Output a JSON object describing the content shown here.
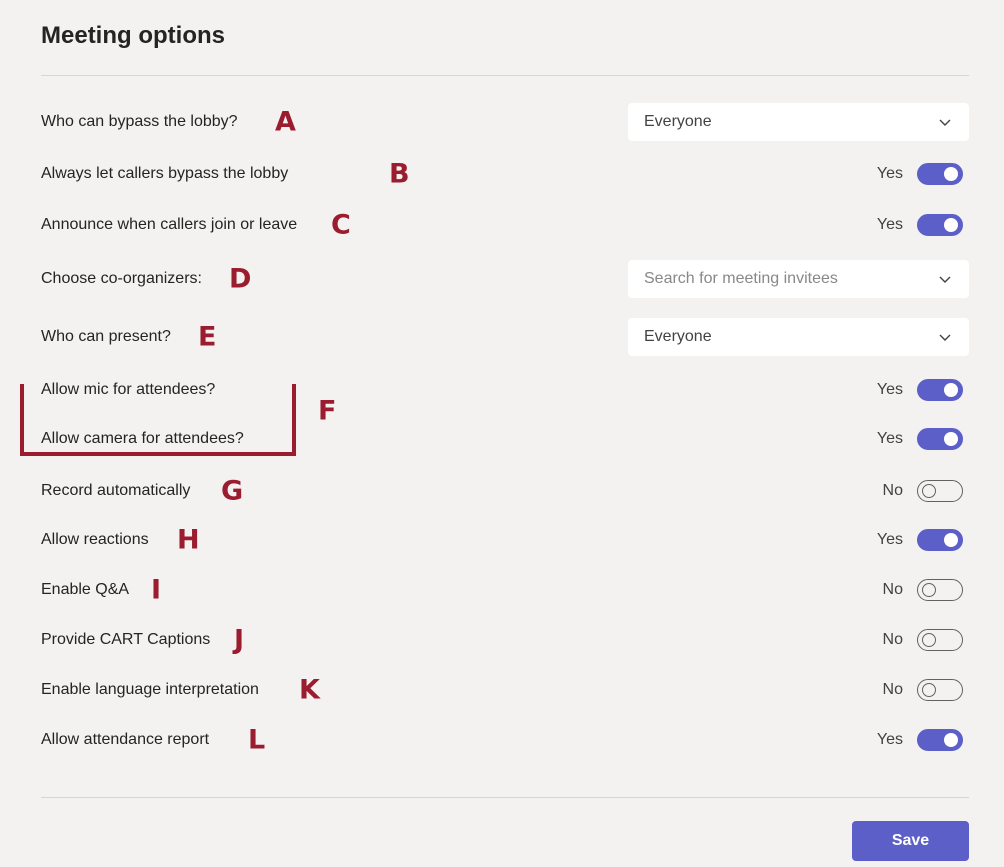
{
  "page": {
    "title": "Meeting options",
    "save_label": "Save"
  },
  "colors": {
    "accent": "#5b5fc7",
    "annotation": "#9b1c2e",
    "background": "#f3f2f1"
  },
  "options": {
    "lobby_bypass": {
      "label": "Who can bypass the lobby?",
      "annotation": "A",
      "value": "Everyone"
    },
    "callers_bypass": {
      "label": "Always let callers bypass the lobby",
      "annotation": "B",
      "state_text": "Yes",
      "on": true
    },
    "announce_callers": {
      "label": "Announce when callers join or leave",
      "annotation": "C",
      "state_text": "Yes",
      "on": true
    },
    "co_organizers": {
      "label": "Choose co-organizers:",
      "annotation": "D",
      "placeholder": "Search for meeting invitees"
    },
    "who_presents": {
      "label": "Who can present?",
      "annotation": "E",
      "value": "Everyone"
    },
    "mic_attendees": {
      "label": "Allow mic for attendees?",
      "state_text": "Yes",
      "on": true
    },
    "camera_attendees": {
      "label": "Allow camera for attendees?",
      "state_text": "Yes",
      "on": true
    },
    "group_annotation": "F",
    "record_auto": {
      "label": "Record automatically",
      "annotation": "G",
      "state_text": "No",
      "on": false
    },
    "reactions": {
      "label": "Allow reactions",
      "annotation": "H",
      "state_text": "Yes",
      "on": true
    },
    "qna": {
      "label": "Enable Q&A",
      "annotation": "I",
      "state_text": "No",
      "on": false
    },
    "cart": {
      "label": "Provide CART Captions",
      "annotation": "J",
      "state_text": "No",
      "on": false
    },
    "interpretation": {
      "label": "Enable language interpretation",
      "annotation": "K",
      "state_text": "No",
      "on": false
    },
    "attendance": {
      "label": "Allow attendance report",
      "annotation": "L",
      "state_text": "Yes",
      "on": true
    }
  }
}
